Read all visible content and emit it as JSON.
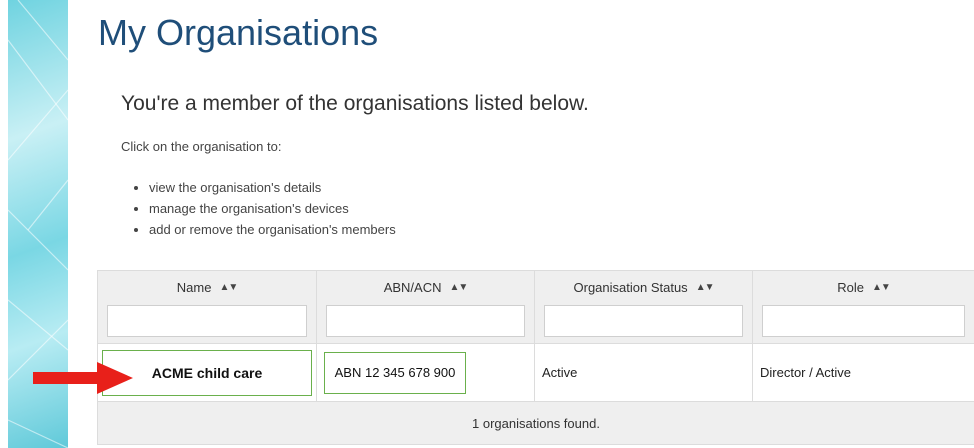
{
  "page": {
    "title": "My Organisations",
    "subtitle": "You're a member of the organisations listed below.",
    "intro": "Click on the organisation to:",
    "bullets": [
      "view the organisation's details",
      "manage the organisation's devices",
      "add or remove the organisation's members"
    ]
  },
  "table": {
    "columns": [
      {
        "label": "Name",
        "sort_icon": "sort-icon"
      },
      {
        "label": "ABN/ACN",
        "sort_icon": "sort-icon"
      },
      {
        "label": "Organisation Status",
        "sort_icon": "sort-icon"
      },
      {
        "label": "Role",
        "sort_icon": "sort-icon"
      }
    ],
    "rows": [
      {
        "name": "ACME child care",
        "abn": "ABN 12 345 678 900",
        "status": "Active",
        "role": "Director / Active"
      }
    ],
    "footer": "1 organisations found."
  },
  "colors": {
    "title": "#1f4e79",
    "highlight_border": "#6ab04c",
    "arrow": "#e8201a",
    "header_bg": "#efefef"
  }
}
